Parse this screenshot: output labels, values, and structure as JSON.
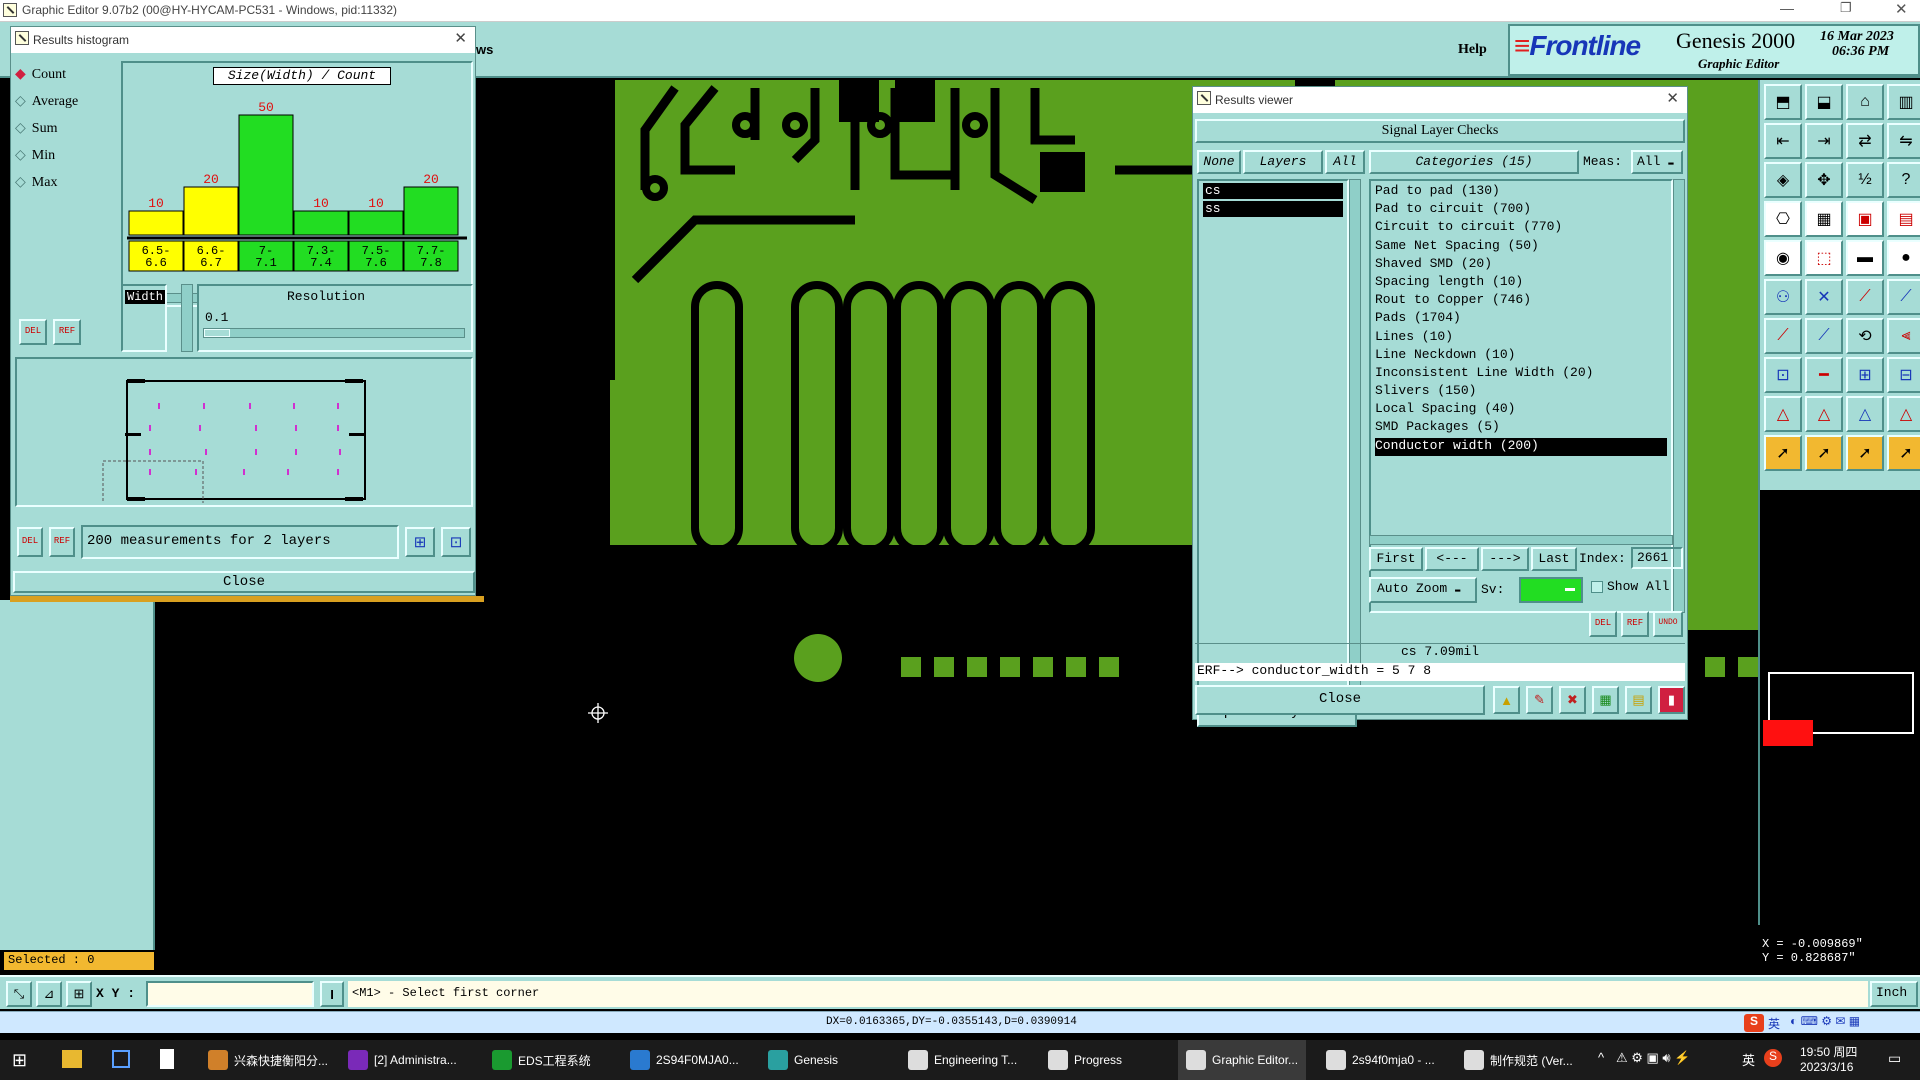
{
  "titlebar": {
    "title": "Graphic Editor 9.07b2 (00@HY-HYCAM-PC531 - Windows, pid:11332)"
  },
  "menubar": {
    "partial": "ws",
    "help": "Help"
  },
  "brand": {
    "logo": "Frontline",
    "product": "Genesis 2000",
    "subtitle": "Graphic Editor",
    "date": "16 Mar 2023",
    "time": "06:36 PM"
  },
  "histogram": {
    "window_title": "Results histogram",
    "modes": [
      "Count",
      "Average",
      "Sum",
      "Min",
      "Max"
    ],
    "selected_mode": "Count",
    "chart_title": "Size(Width) / Count",
    "field_label": "Width",
    "resolution_label": "Resolution",
    "resolution_value": "0.1",
    "status": "200 measurements for 2 layers",
    "close": "Close",
    "del": "DEL",
    "ref": "REF"
  },
  "chart_data": {
    "type": "bar",
    "title": "Size(Width) / Count",
    "categories": [
      "6.5-\n6.6",
      "6.6-\n6.7",
      "7-\n7.1",
      "7.3-\n7.4",
      "7.5-\n7.6",
      "7.7-\n7.8"
    ],
    "category_labels": [
      [
        "6.5-",
        "6.6"
      ],
      [
        "6.6-",
        "6.7"
      ],
      [
        "7-",
        "7.1"
      ],
      [
        "7.3-",
        "7.4"
      ],
      [
        "7.5-",
        "7.6"
      ],
      [
        "7.7-",
        "7.8"
      ]
    ],
    "values": [
      10,
      20,
      50,
      10,
      10,
      20
    ],
    "colors": [
      "#ffff00",
      "#ffff00",
      "#22dd22",
      "#22dd22",
      "#22dd22",
      "#22dd22"
    ],
    "ylim": [
      0,
      50
    ],
    "grid": false
  },
  "results": {
    "window_title": "Results viewer",
    "header": "Signal Layer Checks",
    "none": "None",
    "layers": "Layers",
    "all": "All",
    "categories_btn": "Categories (15)",
    "meas_label": "Meas:",
    "meas_value": "All",
    "layer_list": [
      "cs",
      "ss"
    ],
    "category_list": [
      "Pad to pad (130)",
      "Pad to circuit (700)",
      "Circuit to circuit (770)",
      "Same Net Spacing (50)",
      "Shaved SMD (20)",
      "Spacing length (10)",
      "Rout to Copper (746)",
      "Pads (1704)",
      "Lines (10)",
      "Line Neckdown (10)",
      "Inconsistent Line Width (20)",
      "Slivers (150)",
      "Local Spacing (40)",
      "SMD Packages (5)",
      "Conductor width (200)"
    ],
    "selected_category": "Conductor width (200)",
    "first": "First",
    "prev": "<---",
    "next": "--->",
    "last": "Last",
    "index_label": "Index:",
    "index_value": "2661",
    "auto_zoom": "Auto Zoom",
    "sv": "Sv:",
    "show_all": "Show All",
    "replace_layers": "Replace layers",
    "measure": "cs 7.09mil",
    "erf": "ERF--> conductor_width = 5 7 8",
    "close": "Close",
    "del": "DEL",
    "ref": "REF",
    "undo": "UNDO"
  },
  "status": {
    "selected": "Selected : 0",
    "xy_label": "X Y :",
    "xy_value": "",
    "prompt": "<M1> - Select first corner",
    "units": "Inch",
    "coords_x": "X = -0.009869\"",
    "coords_y": "Y =  0.828687\"",
    "delta": "DX=0.0163365,DY=-0.0355143,D=0.0390914"
  },
  "taskbar": {
    "items": [
      "兴森快捷衡阳分...",
      "[2] Administra...",
      "EDS工程系统",
      "2S94F0MJA0...",
      "Genesis",
      "Engineering T...",
      "Progress",
      "Graphic Editor...",
      "2s94f0mja0 - ...",
      "制作规范 (Ver..."
    ],
    "clock_time": "19:50 周四",
    "clock_date": "2023/3/16",
    "ime": "英",
    "ime2": "英"
  },
  "colors": {
    "teal": "#a6dcd6",
    "copper": "#5aa01e",
    "bright_green": "#22dd22"
  }
}
